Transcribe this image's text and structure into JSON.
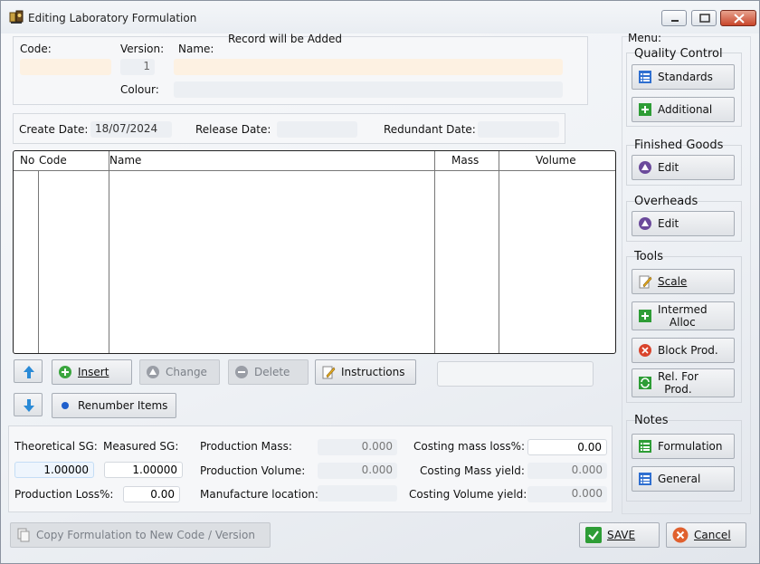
{
  "window": {
    "title": "Editing Laboratory Formulation"
  },
  "header": {
    "code_label": "Code:",
    "code_value": "",
    "version_label": "Version:",
    "version_value": "1",
    "name_label": "Name:",
    "name_value": "",
    "status": "Record will be Added",
    "colour_label": "Colour:",
    "colour_value": ""
  },
  "dates": {
    "create_label": "Create Date:",
    "create_value": "18/07/2024",
    "release_label": "Release Date:",
    "release_value": "",
    "redundant_label": "Redundant Date:",
    "redundant_value": ""
  },
  "grid": {
    "columns": [
      "No",
      "Code",
      "Name",
      "Mass",
      "Volume"
    ],
    "rows": []
  },
  "row_actions": {
    "insert": "Insert",
    "change": "Change",
    "delete": "Delete",
    "instructions": "Instructions",
    "renumber": "Renumber Items"
  },
  "totals": {
    "theoretical_sg_label": "Theoretical SG:",
    "theoretical_sg_value": "1.00000",
    "measured_sg_label": "Measured SG:",
    "measured_sg_value": "1.00000",
    "production_loss_label": "Production Loss%:",
    "production_loss_value": "0.00",
    "production_mass_label": "Production Mass:",
    "production_mass_value": "0.000",
    "production_volume_label": "Production Volume:",
    "production_volume_value": "0.000",
    "manufacture_location_label": "Manufacture location:",
    "manufacture_location_value": "",
    "costing_mass_loss_label": "Costing mass loss%:",
    "costing_mass_loss_value": "0.00",
    "costing_mass_yield_label": "Costing Mass yield:",
    "costing_mass_yield_value": "0.000",
    "costing_volume_yield_label": "Costing Volume yield:",
    "costing_volume_yield_value": "0.000"
  },
  "menu": {
    "title": "Menu:",
    "quality_control": {
      "title": "Quality Control",
      "standards": "Standards",
      "additional": "Additional"
    },
    "finished_goods": {
      "title": "Finished Goods",
      "edit": "Edit"
    },
    "overheads": {
      "title": "Overheads",
      "edit": "Edit"
    },
    "tools": {
      "title": "Tools",
      "scale": "Scale",
      "intermed_alloc_1": "Intermed",
      "intermed_alloc_2": "Alloc",
      "block_prod": "Block Prod.",
      "rel_for_prod_1": "Rel. For",
      "rel_for_prod_2": "Prod."
    },
    "notes": {
      "title": "Notes",
      "formulation": "Formulation",
      "general": "General"
    }
  },
  "footer": {
    "copy": "Copy Formulation to New Code / Version",
    "save": "SAVE",
    "cancel": "Cancel"
  },
  "colors": {
    "accent_green": "#2e9d36",
    "cancel_red": "#d24a22",
    "highlight_blue": "#3a7bd5"
  },
  "icons": [
    "app-icon",
    "minimize-icon",
    "maximize-icon",
    "close-icon",
    "list-icon",
    "plus-icon",
    "triangle-icon",
    "pencil-icon",
    "stop-icon",
    "refresh-icon",
    "arrow-up-icon",
    "arrow-down-icon",
    "bullet-icon",
    "copy-icon",
    "check-icon",
    "cancel-icon"
  ]
}
